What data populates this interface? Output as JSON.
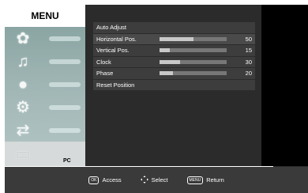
{
  "menu": {
    "title": "MENU",
    "sidebar": [
      {
        "icon": "picture-icon",
        "glyph": "✿"
      },
      {
        "icon": "sound-icon",
        "glyph": "♫"
      },
      {
        "icon": "channel-icon",
        "glyph": "●"
      },
      {
        "icon": "setup-icon",
        "glyph": "⚙"
      },
      {
        "icon": "input-icon",
        "glyph": "⇄"
      },
      {
        "icon": "pc-icon",
        "glyph": "▭"
      }
    ],
    "active_label": "PC"
  },
  "submenu": {
    "auto_adjust": "Auto Adjust",
    "horizontal": {
      "label": "Horizontal Pos.",
      "value": "50",
      "fraction": 0.5
    },
    "vertical": {
      "label": "Vertical Pos.",
      "value": "15",
      "fraction": 0.15
    },
    "clock": {
      "label": "Clock",
      "value": "30",
      "fraction": 0.3
    },
    "phase": {
      "label": "Phase",
      "value": "20",
      "fraction": 0.2
    },
    "reset": "Reset Position"
  },
  "footer": {
    "access_key": "OK",
    "access_label": "Access",
    "select_label": "Select",
    "return_key": "MENU",
    "return_label": "Return"
  }
}
